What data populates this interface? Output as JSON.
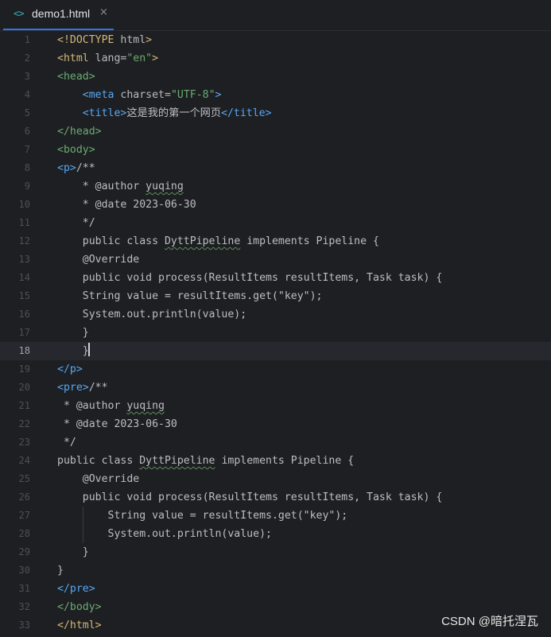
{
  "tab": {
    "icon": "<>",
    "label": "demo1.html",
    "close": "×"
  },
  "lines": [
    {
      "n": "1",
      "parts": [
        [
          "doctype",
          "<!DOCTYPE "
        ],
        [
          "attr",
          "html"
        ],
        [
          "doctype",
          ">"
        ]
      ]
    },
    {
      "n": "2",
      "parts": [
        [
          "tag",
          "<html "
        ],
        [
          "attr",
          "lang="
        ],
        [
          "str",
          "\"en\""
        ],
        [
          "tag",
          ">"
        ]
      ]
    },
    {
      "n": "3",
      "parts": [
        [
          "tag-green",
          "<head>"
        ]
      ]
    },
    {
      "n": "4",
      "parts": [
        [
          "plain",
          "    "
        ],
        [
          "tag-blue",
          "<meta "
        ],
        [
          "attr",
          "charset="
        ],
        [
          "str",
          "\"UTF-8\""
        ],
        [
          "tag-blue",
          ">"
        ]
      ]
    },
    {
      "n": "5",
      "parts": [
        [
          "plain",
          "    "
        ],
        [
          "tag-blue",
          "<title>"
        ],
        [
          "cjk",
          "这是我的第一个网页"
        ],
        [
          "tag-blue",
          "</title>"
        ]
      ]
    },
    {
      "n": "6",
      "parts": [
        [
          "tag-green",
          "</head>"
        ]
      ]
    },
    {
      "n": "7",
      "parts": [
        [
          "tag-green",
          "<body>"
        ]
      ]
    },
    {
      "n": "8",
      "parts": [
        [
          "tag-blue",
          "<p>"
        ],
        [
          "plain",
          "/**"
        ]
      ]
    },
    {
      "n": "9",
      "parts": [
        [
          "plain",
          "    * @author "
        ],
        [
          "wavy",
          "yuqing"
        ]
      ]
    },
    {
      "n": "10",
      "parts": [
        [
          "plain",
          "    * @date 2023-06-30"
        ]
      ]
    },
    {
      "n": "11",
      "parts": [
        [
          "plain",
          "    */"
        ]
      ]
    },
    {
      "n": "12",
      "parts": [
        [
          "plain",
          "    public class "
        ],
        [
          "wavy",
          "DyttPipeline"
        ],
        [
          "plain",
          " implements Pipeline {"
        ]
      ]
    },
    {
      "n": "13",
      "parts": [
        [
          "plain",
          "    @Override"
        ]
      ]
    },
    {
      "n": "14",
      "parts": [
        [
          "plain",
          "    public void process(ResultItems resultItems, Task task) {"
        ]
      ]
    },
    {
      "n": "15",
      "parts": [
        [
          "plain",
          "    String value = resultItems.get(\"key\");"
        ]
      ]
    },
    {
      "n": "16",
      "parts": [
        [
          "plain",
          "    System.out.println(value);"
        ]
      ]
    },
    {
      "n": "17",
      "parts": [
        [
          "plain",
          "    }"
        ]
      ]
    },
    {
      "n": "18",
      "parts": [
        [
          "plain",
          "    }"
        ],
        [
          "caret",
          ""
        ]
      ],
      "current": true
    },
    {
      "n": "19",
      "parts": [
        [
          "tag-blue",
          "</p>"
        ]
      ]
    },
    {
      "n": "20",
      "parts": [
        [
          "tag-blue",
          "<pre>"
        ],
        [
          "plain",
          "/**"
        ]
      ]
    },
    {
      "n": "21",
      "parts": [
        [
          "plain",
          " * @author "
        ],
        [
          "wavy",
          "yuqing"
        ]
      ]
    },
    {
      "n": "22",
      "parts": [
        [
          "plain",
          " * @date 2023-06-30"
        ]
      ]
    },
    {
      "n": "23",
      "parts": [
        [
          "plain",
          " */"
        ]
      ]
    },
    {
      "n": "24",
      "parts": [
        [
          "plain",
          "public class "
        ],
        [
          "wavy",
          "DyttPipeline"
        ],
        [
          "plain",
          " implements Pipeline {"
        ]
      ]
    },
    {
      "n": "25",
      "parts": [
        [
          "plain",
          "    @Override"
        ]
      ]
    },
    {
      "n": "26",
      "parts": [
        [
          "plain",
          "    public void process(ResultItems resultItems, Task task) {"
        ]
      ]
    },
    {
      "n": "27",
      "parts": [
        [
          "plain",
          "        String value = resultItems.get(\"key\");"
        ]
      ]
    },
    {
      "n": "28",
      "parts": [
        [
          "plain",
          "        System.out.println(value);"
        ]
      ]
    },
    {
      "n": "29",
      "parts": [
        [
          "plain",
          "    }"
        ]
      ]
    },
    {
      "n": "30",
      "parts": [
        [
          "plain",
          "}"
        ]
      ]
    },
    {
      "n": "31",
      "parts": [
        [
          "tag-blue",
          "</pre>"
        ]
      ]
    },
    {
      "n": "32",
      "parts": [
        [
          "tag-green",
          "</body>"
        ]
      ]
    },
    {
      "n": "33",
      "parts": [
        [
          "tag",
          "</html>"
        ]
      ]
    }
  ],
  "watermark": "CSDN @暗托涅瓦",
  "colors": {
    "background": "#1e1f22",
    "tab_underline": "#3574f0",
    "tag_yellow": "#d5b778",
    "tag_blue": "#56a8f5",
    "tag_green": "#6aab73",
    "text": "#bcbec4",
    "line_number": "#4b5059",
    "current_line": "#26282e"
  }
}
